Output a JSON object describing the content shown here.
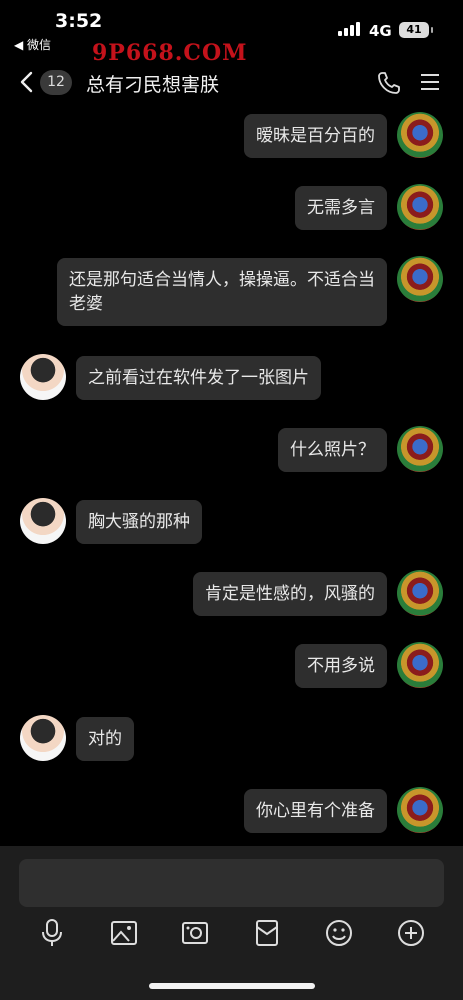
{
  "status_bar": {
    "time": "3:52",
    "back_app": "◀ 微信",
    "watermark": "9P668.COM",
    "network": "4G",
    "battery": "41"
  },
  "header": {
    "unread_count": "12",
    "title": "总有刁民想害朕"
  },
  "messages": [
    {
      "side": "right",
      "avatar": "deity-avatar",
      "text": "暧昧是百分百的"
    },
    {
      "side": "right",
      "avatar": "deity-avatar",
      "text": "无需多言"
    },
    {
      "side": "right",
      "avatar": "deity-avatar",
      "text": "还是那句适合当情人，操操逼。不适合当老婆"
    },
    {
      "side": "left",
      "avatar": "child-avatar",
      "text": "之前看过在软件发了一张图片"
    },
    {
      "side": "right",
      "avatar": "deity-avatar",
      "text": "什么照片？"
    },
    {
      "side": "left",
      "avatar": "child-avatar",
      "text": "胸大骚的那种"
    },
    {
      "side": "right",
      "avatar": "deity-avatar",
      "text": "肯定是性感的，风骚的"
    },
    {
      "side": "right",
      "avatar": "deity-avatar",
      "text": "不用多说"
    },
    {
      "side": "left",
      "avatar": "child-avatar",
      "text": "对的"
    },
    {
      "side": "right",
      "avatar": "deity-avatar",
      "text": "你心里有个准备"
    }
  ],
  "composer": {
    "input_value": "",
    "icons": [
      "microphone-icon",
      "photo-icon",
      "camera-icon",
      "red-packet-icon",
      "emoji-icon",
      "plus-icon"
    ]
  },
  "colors": {
    "background": "#000000",
    "bubble": "#2e2e2e",
    "watermark": "#c4121b"
  }
}
